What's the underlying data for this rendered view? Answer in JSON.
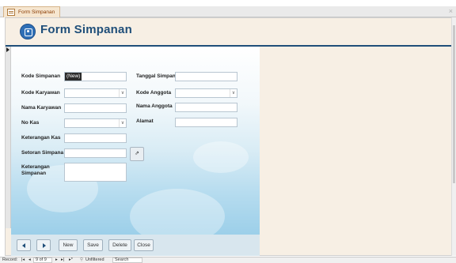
{
  "tab": {
    "title": "Form Simpanan",
    "close_glyph": "×"
  },
  "header": {
    "title": "Form Simpanan"
  },
  "fields": {
    "kode_simpanan": {
      "label": "Kode Simpanan",
      "value": "(New)"
    },
    "tanggal_simpan": {
      "label": "Tanggal Simpan:",
      "value": ""
    },
    "kode_karyawan": {
      "label": "Kode Karyawan",
      "value": ""
    },
    "kode_anggota": {
      "label": "Kode Anggota",
      "value": ""
    },
    "nama_karyawan": {
      "label": "Nama Karyawan",
      "value": ""
    },
    "nama_anggota": {
      "label": "Nama Anggota",
      "value": ""
    },
    "no_kas": {
      "label": "No Kas",
      "value": ""
    },
    "alamat": {
      "label": "Alamat",
      "value": ""
    },
    "keterangan_kas": {
      "label": "Keterangan Kas",
      "value": ""
    },
    "setoran_simpanan": {
      "label": "Setoran Simpana",
      "value": ""
    },
    "keterangan_simpanan": {
      "label": "Keterangan Simpanan",
      "value": ""
    }
  },
  "dropdown_glyph": "∨",
  "pick_button_glyph": "⇗",
  "buttons": {
    "new": "New",
    "save": "Save",
    "delete": "Delete",
    "close": "Close"
  },
  "navbar": {
    "record_label": "Record:",
    "first": "|◂",
    "prev": "◂",
    "position": "9 of 9",
    "next": "▸",
    "last": "▸|",
    "new_record": "▸*",
    "filter": "Unfiltered",
    "search_placeholder": "Search"
  },
  "colors": {
    "accent": "#1f4e79",
    "form_background": "#f7efe4",
    "detail_gradient_bottom": "#9ccfe9"
  }
}
